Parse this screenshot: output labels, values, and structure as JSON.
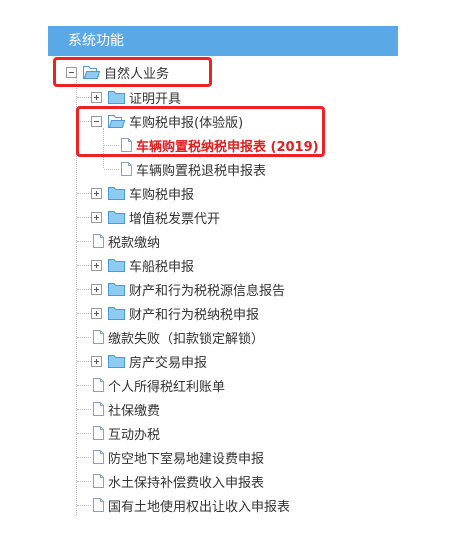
{
  "panel": {
    "title": "系统功能"
  },
  "tree": {
    "root": {
      "label": "自然人业务",
      "expanded": true
    },
    "certificate": {
      "label": "证明开具"
    },
    "vehicle_purchase_trial": {
      "label": "车购税申报(体验版)",
      "expanded": true
    },
    "vehicle_purchase_declaration": {
      "label": "车辆购置税纳税申报表 (2019)",
      "selected": true
    },
    "vehicle_purchase_refund": {
      "label": "车辆购置税退税申报表"
    },
    "vehicle_purchase": {
      "label": "车购税申报"
    },
    "vat_invoice": {
      "label": "增值税发票代开"
    },
    "tax_payment": {
      "label": "税款缴纳"
    },
    "vessel_tax": {
      "label": "车船税申报"
    },
    "property_source_report": {
      "label": "财产和行为税税源信息报告"
    },
    "property_declaration": {
      "label": "财产和行为税纳税申报"
    },
    "payment_failure": {
      "label": "缴款失败（扣款锁定解锁）"
    },
    "real_estate": {
      "label": "房产交易申报"
    },
    "income_tax_dividend": {
      "label": "个人所得税红利账单"
    },
    "social_insurance": {
      "label": "社保缴费"
    },
    "interactive": {
      "label": "互动办税"
    },
    "civil_defense": {
      "label": "防空地下室易地建设费申报"
    },
    "soil_conservation": {
      "label": "水土保持补偿费收入申报表"
    },
    "land_transfer": {
      "label": "国有土地使用权出让收入申报表"
    }
  },
  "colors": {
    "header_bg": "#5aa8e6",
    "highlight_border": "#ee2222",
    "selected_text": "#e02020",
    "folder": "#8ecbf0"
  }
}
